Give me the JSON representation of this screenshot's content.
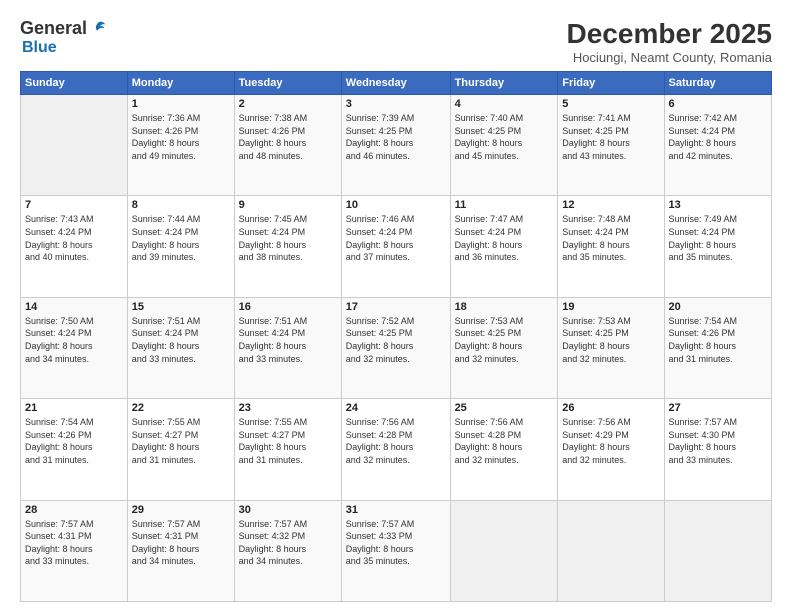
{
  "logo": {
    "general": "General",
    "blue": "Blue"
  },
  "header": {
    "month": "December 2025",
    "location": "Hociungi, Neamt County, Romania"
  },
  "days_of_week": [
    "Sunday",
    "Monday",
    "Tuesday",
    "Wednesday",
    "Thursday",
    "Friday",
    "Saturday"
  ],
  "weeks": [
    [
      {
        "day": "",
        "info": ""
      },
      {
        "day": "1",
        "info": "Sunrise: 7:36 AM\nSunset: 4:26 PM\nDaylight: 8 hours\nand 49 minutes."
      },
      {
        "day": "2",
        "info": "Sunrise: 7:38 AM\nSunset: 4:26 PM\nDaylight: 8 hours\nand 48 minutes."
      },
      {
        "day": "3",
        "info": "Sunrise: 7:39 AM\nSunset: 4:25 PM\nDaylight: 8 hours\nand 46 minutes."
      },
      {
        "day": "4",
        "info": "Sunrise: 7:40 AM\nSunset: 4:25 PM\nDaylight: 8 hours\nand 45 minutes."
      },
      {
        "day": "5",
        "info": "Sunrise: 7:41 AM\nSunset: 4:25 PM\nDaylight: 8 hours\nand 43 minutes."
      },
      {
        "day": "6",
        "info": "Sunrise: 7:42 AM\nSunset: 4:24 PM\nDaylight: 8 hours\nand 42 minutes."
      }
    ],
    [
      {
        "day": "7",
        "info": "Sunrise: 7:43 AM\nSunset: 4:24 PM\nDaylight: 8 hours\nand 40 minutes."
      },
      {
        "day": "8",
        "info": "Sunrise: 7:44 AM\nSunset: 4:24 PM\nDaylight: 8 hours\nand 39 minutes."
      },
      {
        "day": "9",
        "info": "Sunrise: 7:45 AM\nSunset: 4:24 PM\nDaylight: 8 hours\nand 38 minutes."
      },
      {
        "day": "10",
        "info": "Sunrise: 7:46 AM\nSunset: 4:24 PM\nDaylight: 8 hours\nand 37 minutes."
      },
      {
        "day": "11",
        "info": "Sunrise: 7:47 AM\nSunset: 4:24 PM\nDaylight: 8 hours\nand 36 minutes."
      },
      {
        "day": "12",
        "info": "Sunrise: 7:48 AM\nSunset: 4:24 PM\nDaylight: 8 hours\nand 35 minutes."
      },
      {
        "day": "13",
        "info": "Sunrise: 7:49 AM\nSunset: 4:24 PM\nDaylight: 8 hours\nand 35 minutes."
      }
    ],
    [
      {
        "day": "14",
        "info": "Sunrise: 7:50 AM\nSunset: 4:24 PM\nDaylight: 8 hours\nand 34 minutes."
      },
      {
        "day": "15",
        "info": "Sunrise: 7:51 AM\nSunset: 4:24 PM\nDaylight: 8 hours\nand 33 minutes."
      },
      {
        "day": "16",
        "info": "Sunrise: 7:51 AM\nSunset: 4:24 PM\nDaylight: 8 hours\nand 33 minutes."
      },
      {
        "day": "17",
        "info": "Sunrise: 7:52 AM\nSunset: 4:25 PM\nDaylight: 8 hours\nand 32 minutes."
      },
      {
        "day": "18",
        "info": "Sunrise: 7:53 AM\nSunset: 4:25 PM\nDaylight: 8 hours\nand 32 minutes."
      },
      {
        "day": "19",
        "info": "Sunrise: 7:53 AM\nSunset: 4:25 PM\nDaylight: 8 hours\nand 32 minutes."
      },
      {
        "day": "20",
        "info": "Sunrise: 7:54 AM\nSunset: 4:26 PM\nDaylight: 8 hours\nand 31 minutes."
      }
    ],
    [
      {
        "day": "21",
        "info": "Sunrise: 7:54 AM\nSunset: 4:26 PM\nDaylight: 8 hours\nand 31 minutes."
      },
      {
        "day": "22",
        "info": "Sunrise: 7:55 AM\nSunset: 4:27 PM\nDaylight: 8 hours\nand 31 minutes."
      },
      {
        "day": "23",
        "info": "Sunrise: 7:55 AM\nSunset: 4:27 PM\nDaylight: 8 hours\nand 31 minutes."
      },
      {
        "day": "24",
        "info": "Sunrise: 7:56 AM\nSunset: 4:28 PM\nDaylight: 8 hours\nand 32 minutes."
      },
      {
        "day": "25",
        "info": "Sunrise: 7:56 AM\nSunset: 4:28 PM\nDaylight: 8 hours\nand 32 minutes."
      },
      {
        "day": "26",
        "info": "Sunrise: 7:56 AM\nSunset: 4:29 PM\nDaylight: 8 hours\nand 32 minutes."
      },
      {
        "day": "27",
        "info": "Sunrise: 7:57 AM\nSunset: 4:30 PM\nDaylight: 8 hours\nand 33 minutes."
      }
    ],
    [
      {
        "day": "28",
        "info": "Sunrise: 7:57 AM\nSunset: 4:31 PM\nDaylight: 8 hours\nand 33 minutes."
      },
      {
        "day": "29",
        "info": "Sunrise: 7:57 AM\nSunset: 4:31 PM\nDaylight: 8 hours\nand 34 minutes."
      },
      {
        "day": "30",
        "info": "Sunrise: 7:57 AM\nSunset: 4:32 PM\nDaylight: 8 hours\nand 34 minutes."
      },
      {
        "day": "31",
        "info": "Sunrise: 7:57 AM\nSunset: 4:33 PM\nDaylight: 8 hours\nand 35 minutes."
      },
      {
        "day": "",
        "info": ""
      },
      {
        "day": "",
        "info": ""
      },
      {
        "day": "",
        "info": ""
      }
    ]
  ]
}
